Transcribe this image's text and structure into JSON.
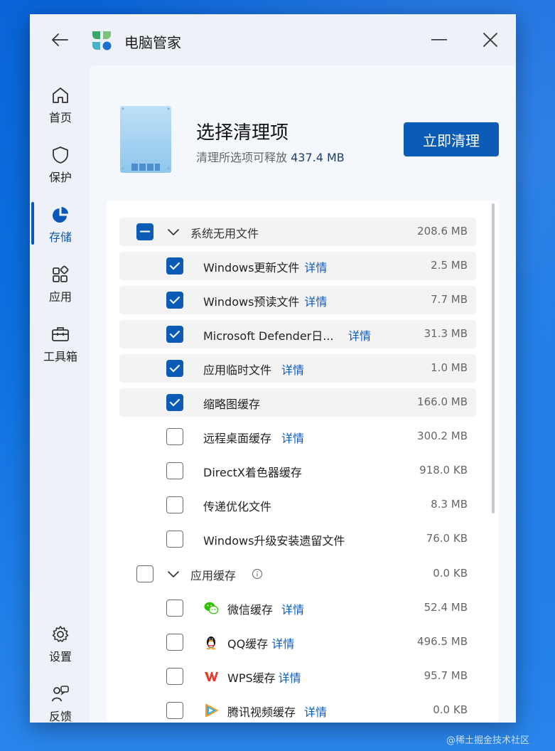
{
  "app": {
    "title": "电脑管家"
  },
  "sidebar": {
    "items": [
      {
        "label": "首页",
        "icon": "home-icon"
      },
      {
        "label": "保护",
        "icon": "shield-icon"
      },
      {
        "label": "存储",
        "icon": "pie-chart-icon",
        "active": true
      },
      {
        "label": "应用",
        "icon": "apps-icon"
      },
      {
        "label": "工具箱",
        "icon": "toolbox-icon"
      }
    ],
    "bottom": [
      {
        "label": "设置",
        "icon": "gear-icon"
      },
      {
        "label": "反馈",
        "icon": "feedback-icon"
      }
    ]
  },
  "header": {
    "title": "选择清理项",
    "subtitle_prefix": "清理所选项可释放",
    "subtitle_amount": "437.4 MB",
    "clean_button": "立即清理"
  },
  "groups": {
    "system": {
      "label": "系统无用文件",
      "size": "208.6 MB",
      "state": "partial",
      "expanded": true
    },
    "apps": {
      "label": "应用缓存",
      "size": "0.0 KB",
      "state": "unchecked",
      "expanded": true
    }
  },
  "detail_label": "详情",
  "system_items": [
    {
      "label": "Windows更新文件",
      "size": "2.5 MB",
      "checked": true,
      "has_detail": true
    },
    {
      "label": "Windows预读文件",
      "size": "7.7 MB",
      "checked": true,
      "has_detail": true
    },
    {
      "label": "Microsoft Defender日...",
      "size": "31.3 MB",
      "checked": true,
      "has_detail": true
    },
    {
      "label": "应用临时文件",
      "size": "1.0 MB",
      "checked": true,
      "has_detail": true
    },
    {
      "label": "缩略图缓存",
      "size": "166.0 MB",
      "checked": true,
      "has_detail": false
    },
    {
      "label": "远程桌面缓存",
      "size": "300.2 MB",
      "checked": false,
      "has_detail": true
    },
    {
      "label": "DirectX着色器缓存",
      "size": "918.0 KB",
      "checked": false,
      "has_detail": false
    },
    {
      "label": "传递优化文件",
      "size": "8.3 MB",
      "checked": false,
      "has_detail": false
    },
    {
      "label": "Windows升级安装遗留文件",
      "size": "76.0 KB",
      "checked": false,
      "has_detail": false
    }
  ],
  "app_items": [
    {
      "label": "微信缓存",
      "size": "52.4 MB",
      "icon": "wechat-icon"
    },
    {
      "label": "QQ缓存",
      "size": "496.5 MB",
      "icon": "qq-penguin-icon"
    },
    {
      "label": "WPS缓存",
      "size": "95.7 MB",
      "icon": "wps-icon"
    },
    {
      "label": "腾讯视频缓存",
      "size": "0.0 KB",
      "icon": "tencent-video-icon"
    }
  ],
  "watermark": "@稀土掘金技术社区",
  "colors": {
    "accent": "#0c5cb7",
    "desktop": "#0b6fe0"
  }
}
